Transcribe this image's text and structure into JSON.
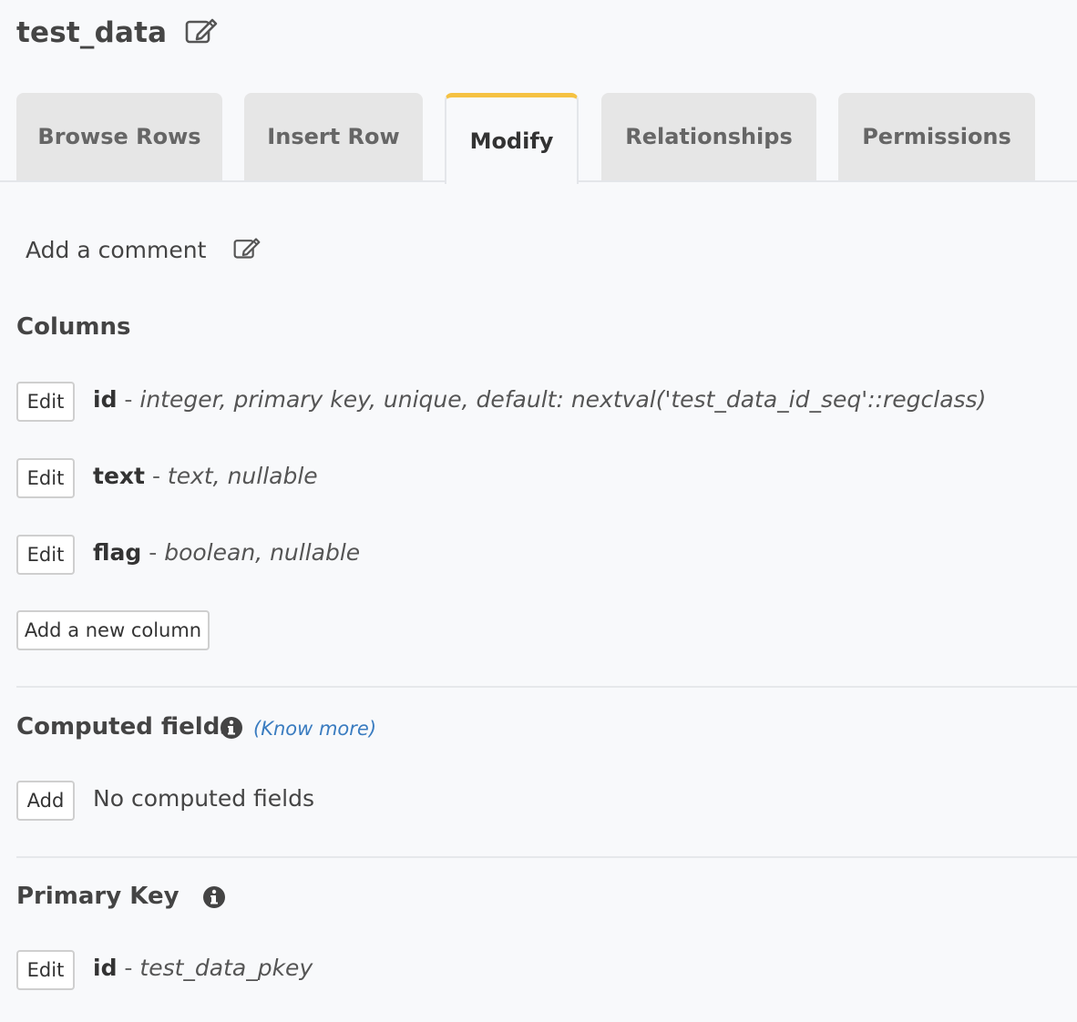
{
  "table": {
    "name": "test_data"
  },
  "tabs": [
    {
      "label": "Browse Rows",
      "active": false
    },
    {
      "label": "Insert Row",
      "active": false
    },
    {
      "label": "Modify",
      "active": true
    },
    {
      "label": "Relationships",
      "active": false
    },
    {
      "label": "Permissions",
      "active": false
    }
  ],
  "comment": {
    "label": "Add a comment"
  },
  "columns": {
    "title": "Columns",
    "edit_label": "Edit",
    "items": [
      {
        "name": "id",
        "sep": "-",
        "details": "integer, primary key, unique, default: nextval('test_data_id_seq'::regclass)"
      },
      {
        "name": "text",
        "sep": "-",
        "details": "text, nullable"
      },
      {
        "name": "flag",
        "sep": "-",
        "details": "boolean, nullable"
      }
    ],
    "add_button": "Add a new column"
  },
  "computed_fields": {
    "title": "Computed fields",
    "know_more": "(Know more)",
    "add_label": "Add",
    "empty_text": "No computed fields"
  },
  "primary_key": {
    "title": "Primary Key",
    "edit_label": "Edit",
    "name": "id",
    "sep": "-",
    "details": "test_data_pkey"
  },
  "icons": {
    "edit": "edit-icon",
    "info": "info-icon"
  },
  "colors": {
    "active_tab_accent": "#f5c242",
    "link": "#3a7cc0",
    "background": "#f8f9fb"
  }
}
